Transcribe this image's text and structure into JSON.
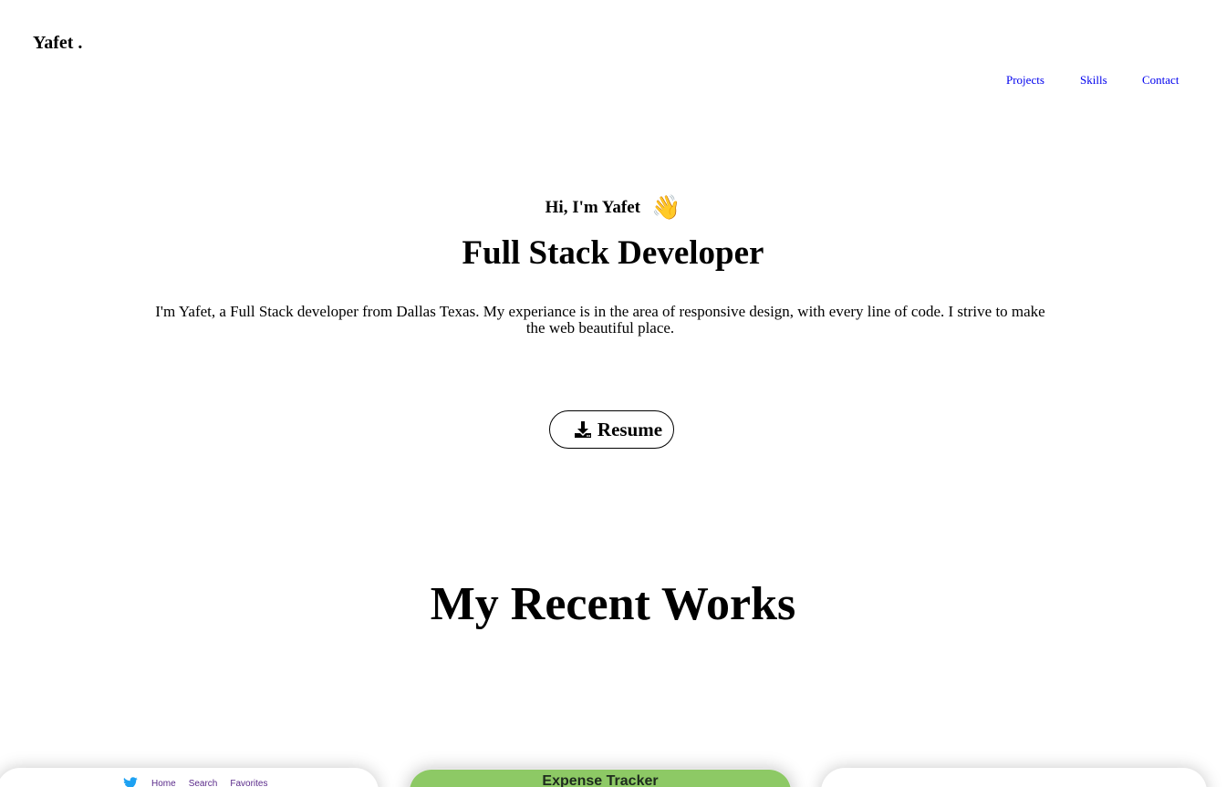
{
  "header": {
    "logo": "Yafet .",
    "nav": [
      "Projects",
      "Skills",
      "Contact"
    ]
  },
  "hero": {
    "greeting": "Hi, I'm Yafet",
    "wave_emoji": "👋",
    "role": "Full Stack Developer",
    "bio": "I'm Yafet, a Full Stack developer from Dallas Texas. My experiance is in the area of responsive design, with every line of code. I strive to make the web beautiful place.",
    "resume_label": "Resume",
    "resume_icon": "download-icon"
  },
  "works": {
    "title": "My Recent Works",
    "cards": [
      {
        "nav": [
          "Home",
          "Search",
          "Favorites"
        ],
        "icon": "twitter-bird-icon"
      },
      {
        "title": "Expense Tracker"
      },
      {}
    ]
  },
  "colors": {
    "link": "#0000ee",
    "twitter_blue": "#1da1f2",
    "expense_green": "#8dc965",
    "twitter_nav_link": "#5a2a8a"
  }
}
